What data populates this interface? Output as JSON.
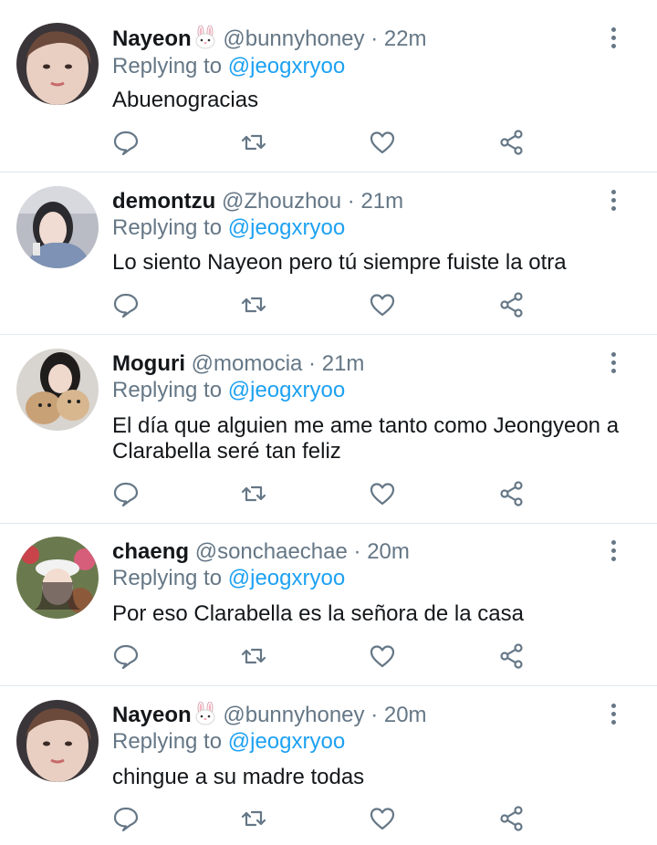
{
  "reply_prefix": "Replying to",
  "colors": {
    "link": "#1da1f2",
    "secondary": "#657786",
    "text": "#14171a",
    "divider": "#e1e8ed"
  },
  "icons": {
    "reply": "reply-icon",
    "retweet": "retweet-icon",
    "like": "heart-icon",
    "share": "share-icon",
    "more": "more-vertical-icon",
    "emoji": "rabbit-face-emoji"
  },
  "tweets": [
    {
      "name": "Nayeon",
      "has_emoji": true,
      "handle": "@bunnyhoney",
      "time": "22m",
      "mention": "@jeogxryoo",
      "text": "Abuenogracias"
    },
    {
      "name": "demontzu",
      "has_emoji": false,
      "handle": "@Zhouzhou",
      "time": "21m",
      "mention": "@jeogxryoo",
      "text": "Lo siento Nayeon pero tú siempre fuiste la otra"
    },
    {
      "name": "Moguri",
      "has_emoji": false,
      "handle": "@momocia",
      "time": "21m",
      "mention": "@jeogxryoo",
      "text": "El día que alguien me ame tanto como Jeongyeon a Clarabella seré tan feliz"
    },
    {
      "name": "chaeng",
      "has_emoji": false,
      "handle": "@sonchaechae",
      "time": "20m",
      "mention": "@jeogxryoo",
      "text": "Por eso Clarabella es la señora de la casa"
    },
    {
      "name": "Nayeon",
      "has_emoji": true,
      "handle": "@bunnyhoney",
      "time": "20m",
      "mention": "@jeogxryoo",
      "text": "chingue a su madre todas"
    }
  ]
}
